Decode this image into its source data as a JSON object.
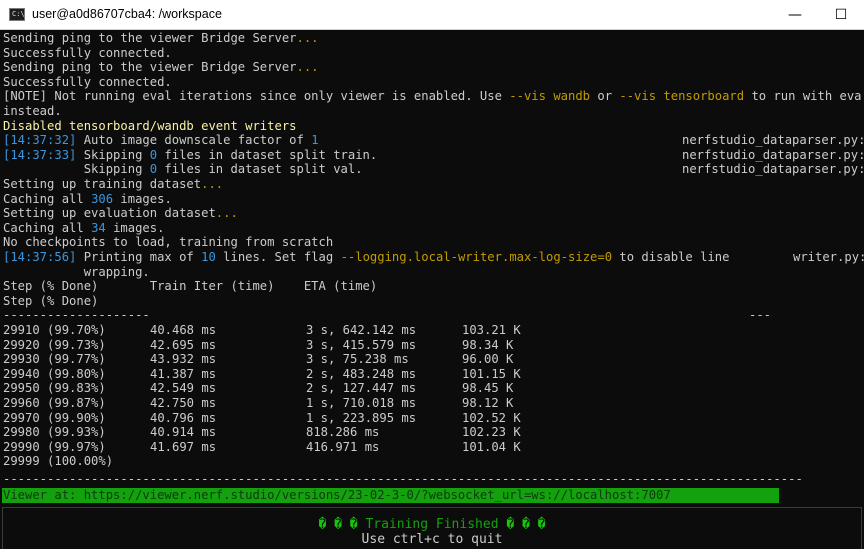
{
  "window": {
    "title": "user@a0d86707cba4: /workspace",
    "icon_label": "C:\\",
    "minimize_glyph": "—",
    "maximize_glyph": "☐"
  },
  "log": {
    "l1_text": "Sending ping to the viewer Bridge Server",
    "l1_dots": "...",
    "l2": "Successfully connected.",
    "l3_text": "Sending ping to the viewer Bridge Server",
    "l3_dots": "...",
    "l4": "Successfully connected.",
    "note_a": "[NOTE] Not running eval iterations since only viewer is enabled. Use ",
    "note_flag1": "--vis wandb",
    "note_b": " or ",
    "note_flag2": "--vis tensorboard",
    "note_c": " to run with eva",
    "note_cont": "instead.",
    "disabled": "Disabled tensorboard/wandb event writers",
    "t1": "[14:37:32]",
    "t1_text_a": " Auto image downscale factor of ",
    "t1_num": "1",
    "t1_src": "nerfstudio_dataparser.py:",
    "t2": "[14:37:33]",
    "t2_text_a": " Skipping ",
    "t2_num": "0",
    "t2_text_b": " files in dataset split train.",
    "t2_src": "nerfstudio_dataparser.py:",
    "t3_text_a": "           Skipping ",
    "t3_num": "0",
    "t3_text_b": " files in dataset split val.",
    "t3_src": "nerfstudio_dataparser.py:",
    "setup_train": "Setting up training dataset",
    "setup_train_dots": "...",
    "caching_a": "Caching all ",
    "caching_num": "306",
    "caching_b": " images.",
    "setup_eval": "Setting up evaluation dataset",
    "setup_eval_dots": "...",
    "caching2_a": "Caching all ",
    "caching2_num": "34",
    "caching2_b": " images.",
    "no_ckpt": "No checkpoints to load, training from scratch",
    "t4": "[14:37:56]",
    "t4_a": " Printing max of ",
    "t4_num": "10",
    "t4_b": " lines. Set flag ",
    "t4_flag": "--logging.local-writer.max-log-size=0",
    "t4_c": " to disable line",
    "t4_src": "writer.py:",
    "t4_cont": "           wrapping.",
    "hdr1": "Step (% Done)       Train Iter (time)    ETA (time)",
    "hdr2": "Step (% Done)",
    "dash_left": "--------------------",
    "dash_right": "---"
  },
  "table": {
    "rows": [
      {
        "step": "29910 (99.70%)",
        "iter": "40.468 ms",
        "eta": "3 s, 642.142 ms",
        "rate": "103.21 K"
      },
      {
        "step": "29920 (99.73%)",
        "iter": "42.695 ms",
        "eta": "3 s, 415.579 ms",
        "rate": "98.34 K"
      },
      {
        "step": "29930 (99.77%)",
        "iter": "43.932 ms",
        "eta": "3 s, 75.238 ms",
        "rate": "96.00 K"
      },
      {
        "step": "29940 (99.80%)",
        "iter": "41.387 ms",
        "eta": "2 s, 483.248 ms",
        "rate": "101.15 K"
      },
      {
        "step": "29950 (99.83%)",
        "iter": "42.549 ms",
        "eta": "2 s, 127.447 ms",
        "rate": "98.45 K"
      },
      {
        "step": "29960 (99.87%)",
        "iter": "42.750 ms",
        "eta": "1 s, 710.018 ms",
        "rate": "98.12 K"
      },
      {
        "step": "29970 (99.90%)",
        "iter": "40.796 ms",
        "eta": "1 s, 223.895 ms",
        "rate": "102.52 K"
      },
      {
        "step": "29980 (99.93%)",
        "iter": "40.914 ms",
        "eta": "818.286 ms",
        "rate": "102.23 K"
      },
      {
        "step": "29990 (99.97%)",
        "iter": "41.697 ms",
        "eta": "416.971 ms",
        "rate": "101.04 K"
      },
      {
        "step": "29999 (100.00%)",
        "iter": "",
        "eta": "",
        "rate": ""
      }
    ]
  },
  "footer": {
    "separator": "-------------------------------------------------------------------------------------------------------------",
    "viewer_url": "Viewer at: https://viewer.nerf.studio/versions/23-02-3-0/?websocket_url=ws://localhost:7007",
    "finished_diamonds_left": "� � �",
    "finished_text": " Training Finished ",
    "finished_diamonds_right": "� � �",
    "quit": "Use ctrl+c to quit"
  },
  "colors": {
    "bg": "#0c0c0c",
    "text": "#cccccc",
    "blue": "#3a96dd",
    "yellow": "#c19c00",
    "green": "#13a10e"
  }
}
